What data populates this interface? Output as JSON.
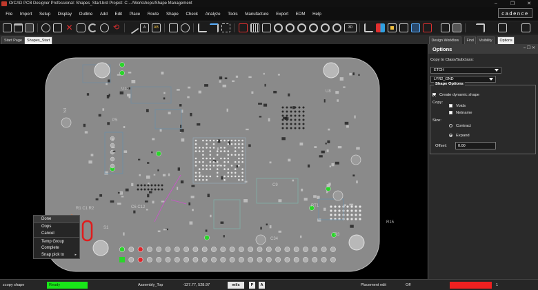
{
  "window": {
    "title": "OrCAD PCB Designer Professional: Shapes_Start.brd  Project: C:.../Workshops/Shape Management",
    "minimize_glyph": "–",
    "restore_glyph": "❐",
    "close_glyph": "✕"
  },
  "menu": [
    "File",
    "Import",
    "Setup",
    "Display",
    "Outline",
    "Add",
    "Edit",
    "Place",
    "Route",
    "Shape",
    "Check",
    "Analyze",
    "Tools",
    "Manufacture",
    "Export",
    "EDM",
    "Help"
  ],
  "brand": "cadence",
  "tabs": [
    {
      "label": "Start Page",
      "active": false
    },
    {
      "label": "Shapes_Start",
      "active": true
    }
  ],
  "context_menu": {
    "items": [
      "Done",
      "Oops",
      "Cancel",
      "Temp Group",
      "Complete",
      "Snap pick to"
    ],
    "submenu_arrow": "▸"
  },
  "panel": {
    "tabs": [
      "Design Workflow",
      "Find",
      "Visibility",
      "Options"
    ],
    "active_tab": "Options",
    "title": "Options",
    "controls": "– ❐ ✕",
    "copy_label": "Copy to Class/Subclass:",
    "class_value": "ETCH",
    "subclass_value": "LYR2_GND",
    "group_title": "Shape Options",
    "create_dynamic_label": "Create dynamic shape",
    "create_dynamic_checked": true,
    "copy_heading": "Copy:",
    "voids_label": "Voids",
    "netname_label": "Netname",
    "size_heading": "Size:",
    "contract_label": "Contract",
    "expand_label": "Expand",
    "size_selected": "Expand",
    "offset_label": "Offset:",
    "offset_value": "0.00"
  },
  "status": {
    "command": "zcopy shape",
    "state": "Ready",
    "view": "Assembly_Top",
    "coords": "-127.77, 528.97",
    "units": "mils",
    "p_button": "P",
    "a_button": "A",
    "mode": "Placement edit",
    "snap": "Off",
    "drc_count": "1"
  },
  "colors": {
    "board": "#8a8a8a",
    "ready": "#19e619",
    "drc": "#ef2020",
    "pad_green": "#2ad52a",
    "pad_red": "#e0242a",
    "arrow": "#f06a2a",
    "ratsnest": "#d050d0"
  }
}
